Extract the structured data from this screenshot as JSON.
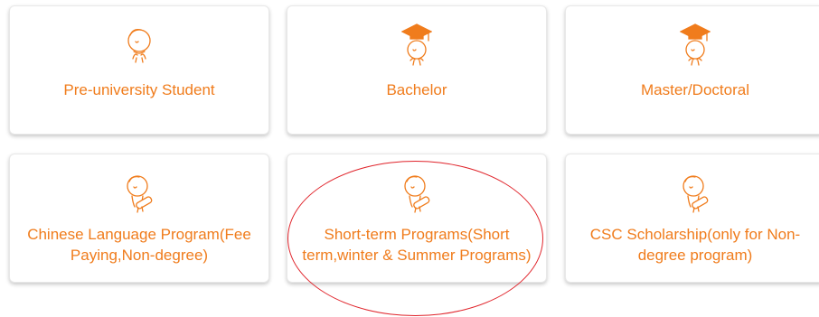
{
  "theme": {
    "accent": "#f07c1c",
    "highlight": "#e0242b"
  },
  "cards": [
    {
      "label": "Pre-university Student",
      "icon": "student-face-icon"
    },
    {
      "label": "Bachelor",
      "icon": "graduation-cap-icon"
    },
    {
      "label": "Master/Doctoral",
      "icon": "graduation-cap-icon"
    },
    {
      "label": "Chinese Language Program(Fee Paying,Non-degree)",
      "icon": "diploma-scroll-icon"
    },
    {
      "label": "Short-term Programs(Short term,winter & Summer Programs)",
      "icon": "diploma-scroll-icon"
    },
    {
      "label": "CSC Scholarship(only for Non-degree program)",
      "icon": "diploma-scroll-icon"
    }
  ]
}
